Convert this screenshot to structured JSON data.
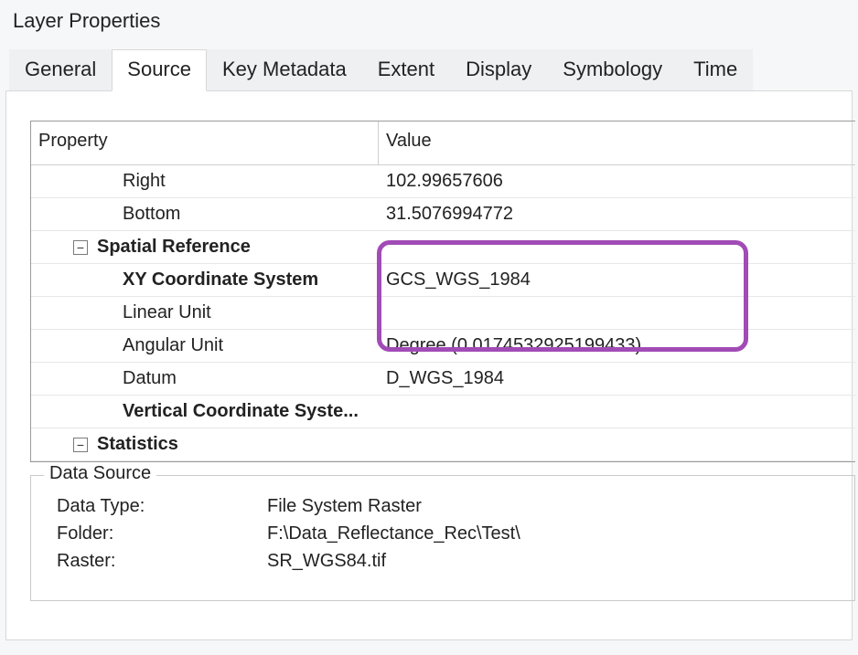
{
  "window": {
    "title": "Layer Properties"
  },
  "tabs": [
    "General",
    "Source",
    "Key Metadata",
    "Extent",
    "Display",
    "Symbology",
    "Time"
  ],
  "active_tab_index": 1,
  "columns": {
    "property": "Property",
    "value": "Value"
  },
  "rows": {
    "right": {
      "label": "Right",
      "value": "102.99657606"
    },
    "bottom": {
      "label": "Bottom",
      "value": "31.5076994772"
    },
    "spatial_ref": {
      "label": "Spatial Reference"
    },
    "xy_cs": {
      "label": "XY Coordinate System",
      "value": "GCS_WGS_1984"
    },
    "lin_unit": {
      "label": "Linear Unit",
      "value": ""
    },
    "ang_unit": {
      "label": "Angular Unit",
      "value": "Degree (0.0174532925199433)"
    },
    "datum": {
      "label": "Datum",
      "value": "D_WGS_1984"
    },
    "vert_cs": {
      "label": "Vertical Coordinate Syste..."
    },
    "stats": {
      "label": "Statistics"
    }
  },
  "expander_glyph": "−",
  "data_source": {
    "legend": "Data Source",
    "items": [
      {
        "label": "Data Type:",
        "value": "File System Raster"
      },
      {
        "label": "Folder:",
        "value": "F:\\Data_Reflectance_Rec\\Test\\"
      },
      {
        "label": "Raster:",
        "value": "SR_WGS84.tif"
      }
    ]
  }
}
